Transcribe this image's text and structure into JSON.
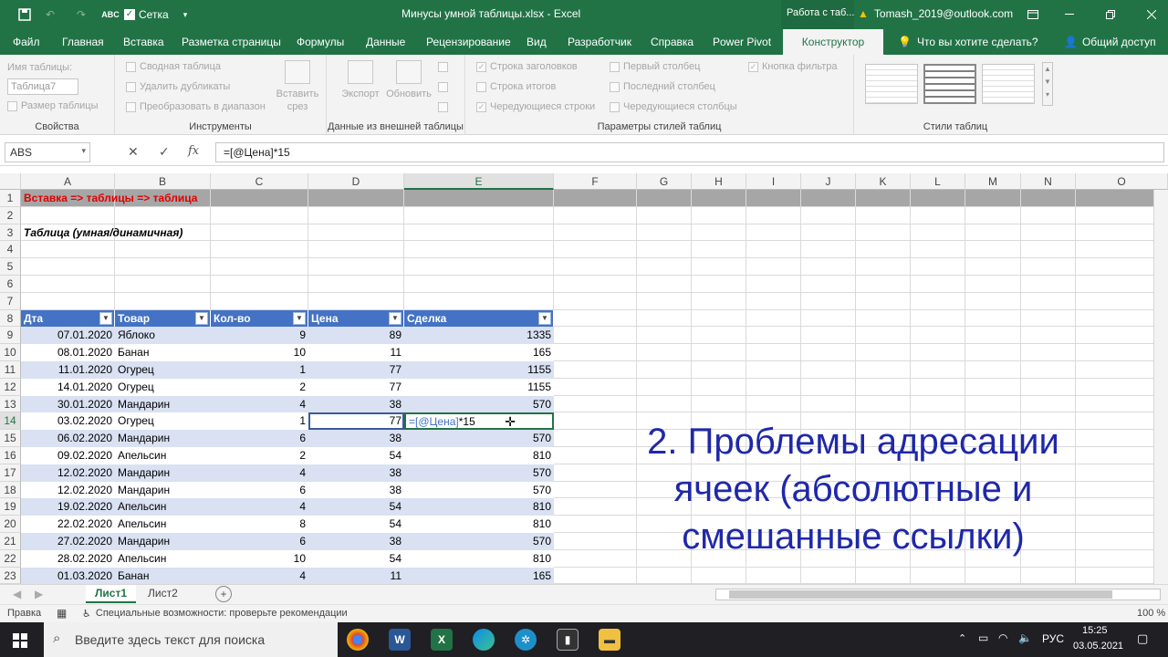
{
  "titlebar": {
    "autosave_label": "Сетка",
    "doc_title": "Минусы умной таблицы.xlsx  -  Excel",
    "context_tab": "Работа с таб...",
    "account": "Tomash_2019@outlook.com"
  },
  "ribbon_tabs": [
    "Файл",
    "Главная",
    "Вставка",
    "Разметка страницы",
    "Формулы",
    "Данные",
    "Рецензирование",
    "Вид",
    "Разработчик",
    "Справка",
    "Power Pivot",
    "Конструктор"
  ],
  "tell_me": "Что вы хотите сделать?",
  "share": "Общий доступ",
  "ribbon": {
    "props": {
      "name_label": "Имя таблицы:",
      "name_value": "Таблица7",
      "resize": "Размер таблицы",
      "group": "Свойства"
    },
    "tools": {
      "pivot": "Сводная таблица",
      "dedupe": "Удалить дубликаты",
      "convert": "Преобразовать в диапазон",
      "slicer_1": "Вставить",
      "slicer_2": "срез",
      "group": "Инструменты"
    },
    "external": {
      "export": "Экспорт",
      "refresh": "Обновить",
      "group": "Данные из внешней таблицы"
    },
    "style_opts": {
      "header_row": "Строка заголовков",
      "total_row": "Строка итогов",
      "banded_rows": "Чередующиеся строки",
      "first_col": "Первый столбец",
      "last_col": "Последний столбец",
      "banded_cols": "Чередующиеся столбцы",
      "filter_btn": "Кнопка фильтра",
      "group": "Параметры стилей таблиц"
    },
    "styles": {
      "group": "Стили таблиц"
    }
  },
  "formula_bar": {
    "name_box": "ABS",
    "formula": "=[@Цена]*15"
  },
  "columns": [
    "A",
    "B",
    "C",
    "D",
    "E",
    "F",
    "G",
    "H",
    "I",
    "J",
    "K",
    "L",
    "M",
    "N",
    "O"
  ],
  "rows": [
    "1",
    "2",
    "3",
    "4",
    "5",
    "6",
    "7",
    "8",
    "9",
    "10",
    "11",
    "12",
    "13",
    "14",
    "15",
    "16",
    "17",
    "18",
    "19",
    "20",
    "21",
    "22",
    "23"
  ],
  "cells": {
    "a1": "Вставка => таблицы => таблица",
    "a3": "Таблица (умная/динамичная)"
  },
  "table": {
    "headers": [
      "Дта",
      "Товар",
      "Кол-во",
      "Цена",
      "Сделка"
    ],
    "rows": [
      [
        "07.01.2020",
        "Яблоко",
        "9",
        "89",
        "1335"
      ],
      [
        "08.01.2020",
        "Банан",
        "10",
        "11",
        "165"
      ],
      [
        "11.01.2020",
        "Огурец",
        "1",
        "77",
        "1155"
      ],
      [
        "14.01.2020",
        "Огурец",
        "2",
        "77",
        "1155"
      ],
      [
        "30.01.2020",
        "Мандарин",
        "4",
        "38",
        "570"
      ],
      [
        "03.02.2020",
        "Огурец",
        "1",
        "77",
        ""
      ],
      [
        "06.02.2020",
        "Мандарин",
        "6",
        "38",
        "570"
      ],
      [
        "09.02.2020",
        "Апельсин",
        "2",
        "54",
        "810"
      ],
      [
        "12.02.2020",
        "Мандарин",
        "4",
        "38",
        "570"
      ],
      [
        "12.02.2020",
        "Мандарин",
        "6",
        "38",
        "570"
      ],
      [
        "19.02.2020",
        "Апельсин",
        "4",
        "54",
        "810"
      ],
      [
        "22.02.2020",
        "Апельсин",
        "8",
        "54",
        "810"
      ],
      [
        "27.02.2020",
        "Мандарин",
        "6",
        "38",
        "570"
      ],
      [
        "28.02.2020",
        "Апельсин",
        "10",
        "54",
        "810"
      ],
      [
        "01.03.2020",
        "Банан",
        "4",
        "11",
        "165"
      ]
    ],
    "edit_ref": "=[@Цена]",
    "edit_tail": "*15"
  },
  "overlay": {
    "line1": "2. Проблемы адресации",
    "line2": "ячеек (абсолютные и",
    "line3": "смешанные ссылки)"
  },
  "sheets": [
    "Лист1",
    "Лист2"
  ],
  "status": {
    "mode": "Правка",
    "accessibility": "Специальные возможности: проверьте рекомендации",
    "zoom": "100 %"
  },
  "taskbar": {
    "search_placeholder": "Введите здесь текст для поиска",
    "lang": "РУС",
    "time": "15:25",
    "date": "03.05.2021"
  },
  "colors": {
    "excel_green": "#217346",
    "table_header": "#4472c4",
    "band": "#d9e1f2",
    "overlay_text": "#1f28a8"
  }
}
